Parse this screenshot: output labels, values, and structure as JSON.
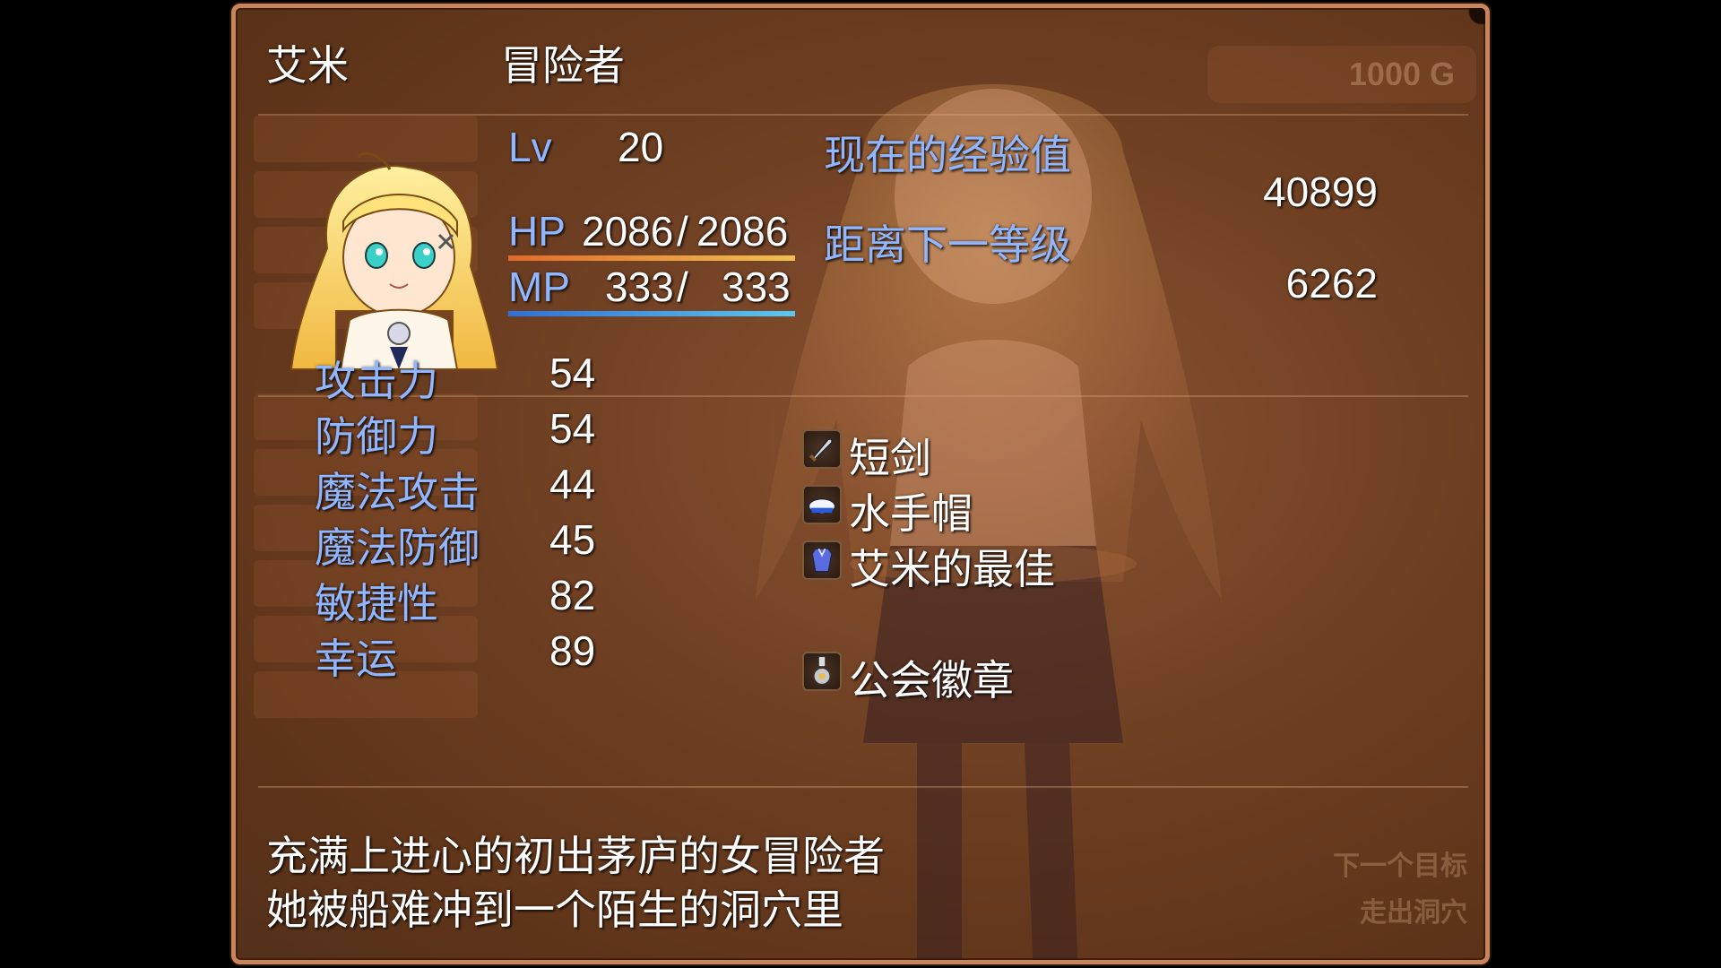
{
  "window": {
    "name": "艾米",
    "class": "冒险者"
  },
  "level": {
    "label": "Lv",
    "value": "20"
  },
  "exp": {
    "current_label": "现在的经验值",
    "current_value": "40899",
    "next_label": "距离下一等级",
    "next_value": "6262"
  },
  "hp": {
    "label": "HP",
    "current": "2086",
    "separator": "/",
    "max": "2086",
    "fraction": 1.0
  },
  "mp": {
    "label": "MP",
    "current": "333",
    "separator": "/",
    "max": "333",
    "fraction": 1.0
  },
  "stats": [
    {
      "label": "攻击力",
      "value": "54"
    },
    {
      "label": "防御力",
      "value": "54"
    },
    {
      "label": "魔法攻击",
      "value": "44"
    },
    {
      "label": "魔法防御",
      "value": "45"
    },
    {
      "label": "敏捷性",
      "value": "82"
    },
    {
      "label": "幸运",
      "value": "89"
    }
  ],
  "equipment": [
    {
      "name": "短剑",
      "icon": "dagger-icon"
    },
    {
      "name": "水手帽",
      "icon": "sailor-hat-icon"
    },
    {
      "name": "艾米的最佳",
      "icon": "outfit-icon"
    },
    {
      "name": "",
      "icon": ""
    },
    {
      "name": "公会徽章",
      "icon": "guild-badge-icon"
    }
  ],
  "description": {
    "line1": "充满上进心的初出茅庐的女冒险者",
    "line2": "她被船难冲到一个陌生的洞穴里"
  },
  "background_ghost": {
    "gold": "1000 G",
    "bottom_right_1": "下一个目标",
    "bottom_right_2": "走出洞穴"
  },
  "colors": {
    "label_blue": "#8fb6ff",
    "text_white": "#ffffff",
    "window_border": "#c8845a",
    "hp_gauge_start": "#e06a2a",
    "hp_gauge_end": "#f0c050",
    "mp_gauge_start": "#2e70d8",
    "mp_gauge_end": "#59c8f0"
  }
}
